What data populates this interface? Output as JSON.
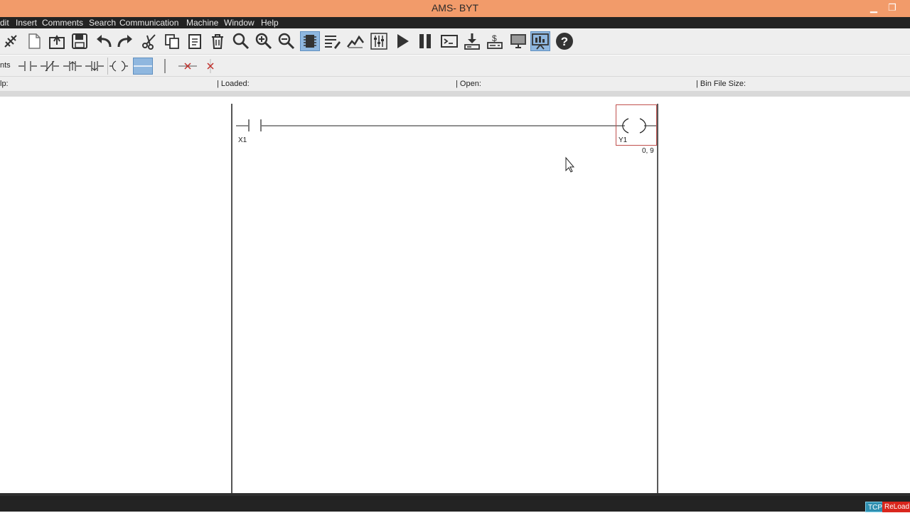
{
  "window": {
    "title": "AMS- BYT",
    "minimize_glyph": "▁",
    "restore_glyph": "❐"
  },
  "menu": {
    "items": [
      "dit",
      "Insert",
      "Comments",
      "Search",
      "Communication",
      "Machine",
      "Window",
      "Help"
    ]
  },
  "toolbar": {
    "icons": [
      "connect-icon",
      "new-file-icon",
      "open-file-icon",
      "save-icon",
      "undo-icon",
      "redo-icon",
      "cut-icon",
      "copy-icon",
      "paste-icon",
      "delete-icon",
      "search-icon",
      "zoom-in-icon",
      "zoom-out-icon",
      "chip-icon",
      "list-edit-icon",
      "signal-icon",
      "sliders-icon",
      "run-icon",
      "pause-icon",
      "terminal-icon",
      "download-icon",
      "upload-icon",
      "monitor-icon",
      "presentation-icon",
      "help-icon"
    ],
    "active": [
      "chip-icon",
      "presentation-icon"
    ]
  },
  "element_bar": {
    "label": "nts",
    "tools": [
      "no-contact-icon",
      "nc-contact-icon",
      "rising-edge-contact-icon",
      "falling-edge-contact-icon",
      "coil-icon",
      "horizontal-line-icon",
      "vertical-line-icon",
      "delete-horizontal-icon",
      "delete-vertical-icon"
    ],
    "active": "horizontal-line-icon"
  },
  "status": {
    "p_label": "lp:",
    "loaded_label": "| Loaded:",
    "open_label": "| Open:",
    "bin_label": "| Bin File Size:"
  },
  "ladder": {
    "contact_label": "X1",
    "coil_label": "Y1",
    "cursor_position": "0, 9"
  },
  "bottom": {
    "tcp_label": "TCP",
    "reload_label": "ReLoad"
  },
  "colors": {
    "titlebar": "#f29b6a",
    "menubar": "#232323",
    "selection_box": "#c0504d",
    "active_button": "#8fb7df",
    "reload_badge": "#d9261c",
    "tcp_badge": "#2f8fb0"
  }
}
